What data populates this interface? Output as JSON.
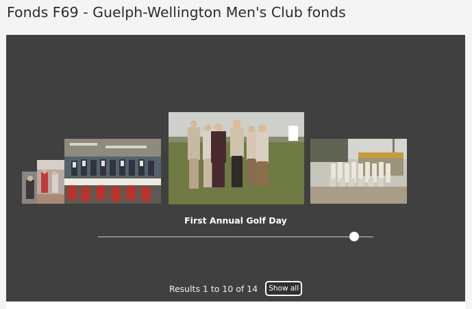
{
  "page": {
    "title": "Fonds F69 - Guelph-Wellington Men's Club fonds"
  },
  "carousel": {
    "current_caption": "First Annual Golf Day",
    "results_text": "Results 1 to 10 of 14",
    "show_all_label": "Show all",
    "slider_position_fraction": 0.93,
    "background_color": "#404040"
  }
}
